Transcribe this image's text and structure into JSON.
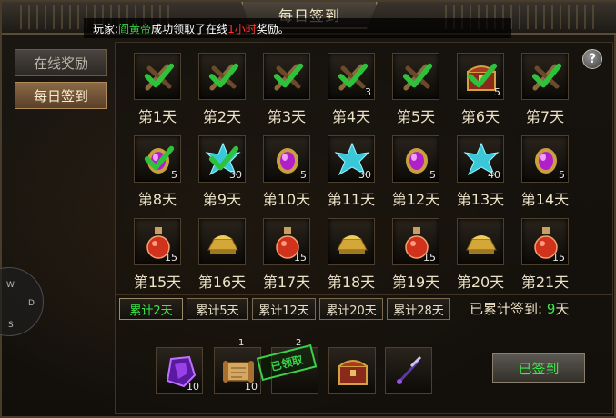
{
  "window": {
    "title": "每日签到"
  },
  "tabs": [
    {
      "label": "在线奖励",
      "state": "inactive"
    },
    {
      "label": "每日签到",
      "state": "active"
    }
  ],
  "banner": {
    "prefix": "玩家:",
    "player": "阎黄帝",
    "middle": "成功领取了在线",
    "duration": "1小时",
    "suffix": "奖励。"
  },
  "help": {
    "label": "?"
  },
  "days": [
    {
      "label": "第1天",
      "icon": "crossed-sticks-icon",
      "count": "",
      "claimed": true
    },
    {
      "label": "第2天",
      "icon": "crossed-sticks-icon",
      "count": "",
      "claimed": true
    },
    {
      "label": "第3天",
      "icon": "crossed-sticks-icon",
      "count": "",
      "claimed": true
    },
    {
      "label": "第4天",
      "icon": "crossed-sticks-icon",
      "count": "3",
      "claimed": true
    },
    {
      "label": "第5天",
      "icon": "crossed-sticks-icon",
      "count": "",
      "claimed": true
    },
    {
      "label": "第6天",
      "icon": "treasure-chest-icon",
      "count": "5",
      "claimed": true
    },
    {
      "label": "第7天",
      "icon": "crossed-sticks-icon",
      "count": "",
      "claimed": true
    },
    {
      "label": "第8天",
      "icon": "purple-gem-icon",
      "count": "5",
      "claimed": true
    },
    {
      "label": "第9天",
      "icon": "cyan-crystal-icon",
      "count": "30",
      "claimed": true
    },
    {
      "label": "第10天",
      "icon": "purple-gem-icon",
      "count": "5",
      "claimed": false
    },
    {
      "label": "第11天",
      "icon": "cyan-crystal-icon",
      "count": "30",
      "claimed": false
    },
    {
      "label": "第12天",
      "icon": "purple-gem-icon",
      "count": "5",
      "claimed": false
    },
    {
      "label": "第13天",
      "icon": "cyan-crystal-icon",
      "count": "40",
      "claimed": false
    },
    {
      "label": "第14天",
      "icon": "purple-gem-icon",
      "count": "5",
      "claimed": false
    },
    {
      "label": "第15天",
      "icon": "red-potion-icon",
      "count": "15",
      "claimed": false
    },
    {
      "label": "第16天",
      "icon": "gold-ingot-icon",
      "count": "",
      "claimed": false
    },
    {
      "label": "第17天",
      "icon": "red-potion-icon",
      "count": "15",
      "claimed": false
    },
    {
      "label": "第18天",
      "icon": "gold-ingot-icon",
      "count": "",
      "claimed": false
    },
    {
      "label": "第19天",
      "icon": "red-potion-icon",
      "count": "15",
      "claimed": false
    },
    {
      "label": "第20天",
      "icon": "gold-ingot-icon",
      "count": "",
      "claimed": false
    },
    {
      "label": "第21天",
      "icon": "red-potion-icon",
      "count": "15",
      "claimed": false
    }
  ],
  "cumulative": {
    "buttons": [
      {
        "label": "累计2天",
        "selected": true
      },
      {
        "label": "累计5天",
        "selected": false
      },
      {
        "label": "累计12天",
        "selected": false
      },
      {
        "label": "累计20天",
        "selected": false
      },
      {
        "label": "累计28天",
        "selected": false
      }
    ],
    "status_prefix": "已累计签到:",
    "status_value": "9",
    "status_unit": "天"
  },
  "rewards": [
    {
      "icon": "purple-ore-icon",
      "count": "10",
      "top": ""
    },
    {
      "icon": "scroll-icon",
      "count": "10",
      "top": "1"
    },
    {
      "icon": "empty-slot-icon",
      "count": "",
      "top": "2"
    },
    {
      "icon": "treasure-chest-icon",
      "count": "",
      "top": ""
    },
    {
      "icon": "dagger-icon",
      "count": "",
      "top": ""
    }
  ],
  "stamp": {
    "label": "已领取"
  },
  "sign_button": {
    "label": "已签到"
  },
  "compass": {
    "w": "W",
    "d": "D",
    "s": "S"
  },
  "colors": {
    "accent_green": "#3ce84a",
    "highlight_red": "#ff3333",
    "gold_text": "#ece2c8"
  }
}
